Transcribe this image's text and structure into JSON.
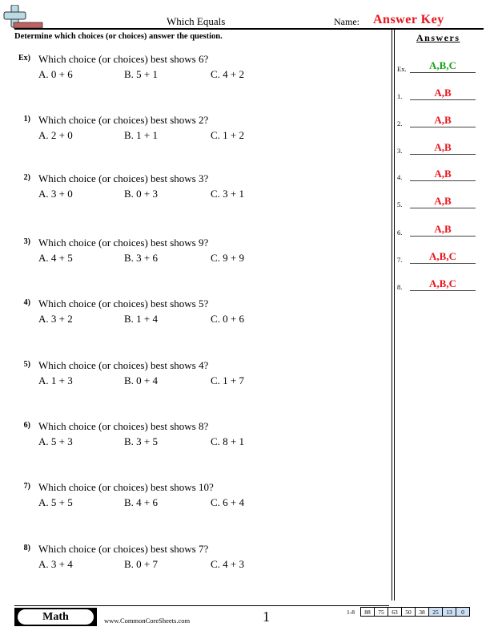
{
  "header": {
    "title": "Which Equals",
    "name_label": "Name:",
    "name_value": "Answer Key",
    "instructions": "Determine which choices (or choices) answer the question.",
    "answers_heading": "Answers"
  },
  "questions": [
    {
      "num": "Ex)",
      "text": "Which choice (or choices) best shows 6?",
      "choices": [
        "A. 0 + 6",
        "B. 5 + 1",
        "C. 4 + 2"
      ]
    },
    {
      "num": "1)",
      "text": "Which choice (or choices) best shows 2?",
      "choices": [
        "A. 2 + 0",
        "B. 1 + 1",
        "C. 1 + 2"
      ]
    },
    {
      "num": "2)",
      "text": "Which choice (or choices) best shows 3?",
      "choices": [
        "A. 3 + 0",
        "B. 0 + 3",
        "C. 3 + 1"
      ]
    },
    {
      "num": "3)",
      "text": "Which choice (or choices) best shows 9?",
      "choices": [
        "A. 4 + 5",
        "B. 3 + 6",
        "C. 9 + 9"
      ]
    },
    {
      "num": "4)",
      "text": "Which choice (or choices) best shows 5?",
      "choices": [
        "A. 3 + 2",
        "B. 1 + 4",
        "C. 0 + 6"
      ]
    },
    {
      "num": "5)",
      "text": "Which choice (or choices) best shows 4?",
      "choices": [
        "A. 1 + 3",
        "B. 0 + 4",
        "C. 1 + 7"
      ]
    },
    {
      "num": "6)",
      "text": "Which choice (or choices) best shows 8?",
      "choices": [
        "A. 5 + 3",
        "B. 3 + 5",
        "C. 8 + 1"
      ]
    },
    {
      "num": "7)",
      "text": "Which choice (or choices) best shows 10?",
      "choices": [
        "A. 5 + 5",
        "B. 4 + 6",
        "C. 6 + 4"
      ]
    },
    {
      "num": "8)",
      "text": "Which choice (or choices) best shows 7?",
      "choices": [
        "A. 3 + 4",
        "B. 0 + 7",
        "C. 4 + 3"
      ]
    }
  ],
  "answers": [
    {
      "label": "Ex.",
      "value": "A,B,C"
    },
    {
      "label": "1.",
      "value": "A,B"
    },
    {
      "label": "2.",
      "value": "A,B"
    },
    {
      "label": "3.",
      "value": "A,B"
    },
    {
      "label": "4.",
      "value": "A,B"
    },
    {
      "label": "5.",
      "value": "A,B"
    },
    {
      "label": "6.",
      "value": "A,B"
    },
    {
      "label": "7.",
      "value": "A,B,C"
    },
    {
      "label": "8.",
      "value": "A,B,C"
    }
  ],
  "footer": {
    "subject": "Math",
    "site": "www.CommonCoreSheets.com",
    "page": "1",
    "score_label": "1-8",
    "scores": [
      "88",
      "75",
      "63",
      "50",
      "38",
      "25",
      "13",
      "0"
    ]
  },
  "colors": {
    "answer_red": "#e8141b",
    "example_green": "#1aa31a",
    "score_blue": "#cfe0f5"
  }
}
